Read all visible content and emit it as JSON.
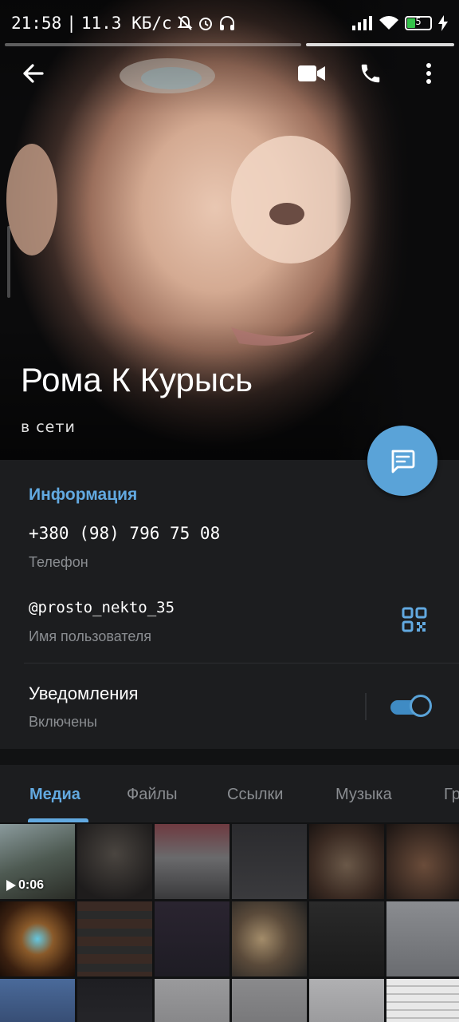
{
  "status_bar": {
    "time": "21:58",
    "separator": "|",
    "speed": "11.3 КБ/с",
    "battery": "5"
  },
  "profile": {
    "name": "Рома К Курысь",
    "presence": "в сети"
  },
  "info": {
    "title": "Информация",
    "phone_value": "+380 (98) 796 75 08",
    "phone_label": "Телефон",
    "username_value": "@prosto_nekto_35",
    "username_label": "Имя пользователя",
    "notifications_label": "Уведомления",
    "notifications_state": "Включены",
    "notifications_on": true
  },
  "tabs": [
    "Медиа",
    "Файлы",
    "Ссылки",
    "Музыка",
    "Гр"
  ],
  "media": {
    "first_video_duration": "0:06"
  },
  "colors": {
    "accent": "#62a9e0",
    "fab": "#5aa3d8",
    "panel": "#1c1d1f",
    "background": "#111213"
  },
  "icons": [
    "back-arrow-icon",
    "video-call-icon",
    "phone-icon",
    "more-vertical-icon",
    "message-icon",
    "qr-code-icon",
    "play-icon"
  ]
}
